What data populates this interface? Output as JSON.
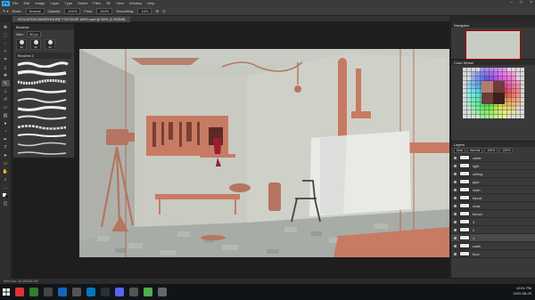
{
  "menubar": {
    "logo": "Ps",
    "items": [
      "File",
      "Edit",
      "Image",
      "Layer",
      "Type",
      "Select",
      "Filter",
      "3D",
      "View",
      "Window",
      "Help"
    ]
  },
  "options": {
    "mode_label": "Mode:",
    "mode_value": "Normal",
    "opacity_label": "Opacity:",
    "opacity_value": "100%",
    "flow_label": "Flow:",
    "flow_value": "100%",
    "smoothing_label": "Smoothing:",
    "smoothing_value": "10%"
  },
  "document_tab": {
    "title": "ISOLATION WAREHOUSE FOOTAGE WHO.psd @ 50% (1 RGB/8)"
  },
  "brushes_panel": {
    "title": "Brushes",
    "size_label": "Size:",
    "size_value": "30 px",
    "presets": [
      "30",
      "30",
      "30"
    ],
    "group_name": "Brushes 1"
  },
  "navigator_panel": {
    "title": "Navigator"
  },
  "swatches_panel": {
    "title": "Color Wheel"
  },
  "layers_panel": {
    "title": "Layers",
    "filter_value": "Kind",
    "blend_value": "Normal",
    "opacity_value": "100%",
    "fill_value": "100%",
    "layers": [
      "cable",
      "light",
      "ceiling",
      "pipe",
      "cloth",
      "tripod",
      "chair",
      "bench",
      "3",
      "2",
      "1",
      "walls",
      "floor"
    ],
    "selected_index": 10
  },
  "status": {
    "text": "50%    Doc: 34.4M/182.3M"
  },
  "tray": {
    "time": "10:51 PM",
    "date": "2020-08-29"
  },
  "colors": {
    "accent": "#2fa6ff",
    "props": "#c77b63",
    "wall": "#c9ccc3"
  }
}
